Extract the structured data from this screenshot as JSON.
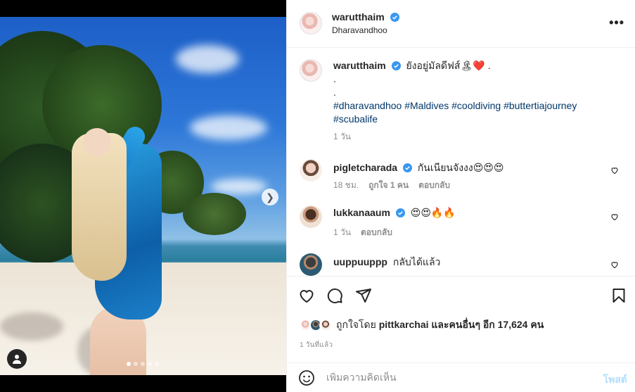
{
  "post": {
    "author": {
      "username": "warutthaim",
      "verified": true,
      "location": "Dharavandhoo"
    },
    "caption": {
      "text": "ยังอยู่มัลดีฟส์🏝❤️ .",
      "line2": ".",
      "line3": ".",
      "hashtags": [
        "#dharavandhoo",
        "#Maldives",
        "#cooldiving",
        "#buttertiajourney",
        "#scubalife"
      ],
      "time": "1 วัน"
    },
    "comments": [
      {
        "username": "pigletcharada",
        "verified": true,
        "text": "กันเนียนจังงง😍😍😍",
        "time": "18 ชม.",
        "likes": "ถูกใจ 1 คน",
        "reply": "ตอบกลับ"
      },
      {
        "username": "lukkanaaum",
        "verified": true,
        "text": "😍😍🔥🔥",
        "time": "1 วัน",
        "reply": "ตอบกลับ"
      },
      {
        "username": "uuppuuppp",
        "verified": false,
        "text": "กลับได้แล้ว"
      }
    ],
    "likes": {
      "prefix": "ถูกใจโดย",
      "by": "pittkarchai",
      "middle": "และคนอื่นๆ อีก",
      "count": "17,624",
      "suffix": "คน"
    },
    "posted_time": "1 วันที่แล้ว",
    "carousel": {
      "total": 5,
      "active": 0
    }
  },
  "comment_box": {
    "placeholder": "เพิ่มความคิดเห็น",
    "post_label": "โพสต์"
  },
  "icons": {
    "more": "more-options-icon",
    "heart": "heart-icon",
    "comment": "comment-icon",
    "share": "share-icon",
    "save": "bookmark-icon",
    "emoji": "emoji-icon",
    "next": "chevron-right-icon",
    "tag": "user-tag-icon"
  },
  "colors": {
    "verified": "#3897f0",
    "hashtag": "#00376b",
    "muted": "#8e8e8e",
    "post_button": "#b2dffc"
  }
}
